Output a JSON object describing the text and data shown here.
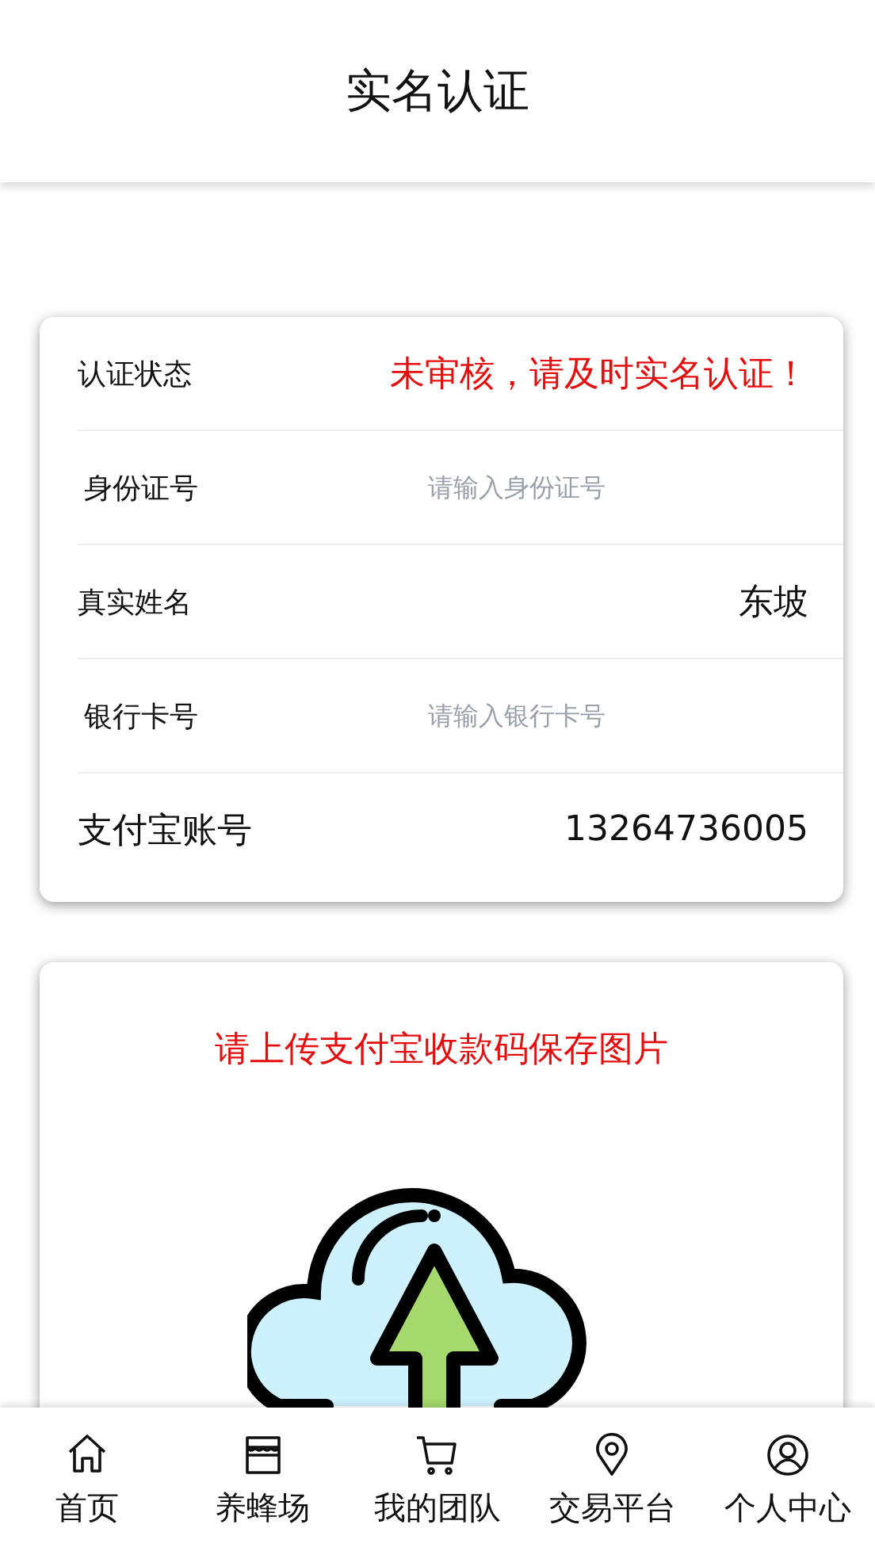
{
  "header": {
    "title": "实名认证"
  },
  "form": [
    {
      "kind": "status",
      "label": "认证状态",
      "value": "未审核，请及时实名认证！"
    },
    {
      "kind": "input",
      "label": "身份证号",
      "placeholder": "请输入身份证号"
    },
    {
      "kind": "value",
      "label": "真实姓名",
      "value": "东坡"
    },
    {
      "kind": "input",
      "label": "银行卡号",
      "placeholder": "请输入银行卡号"
    },
    {
      "kind": "value",
      "label": "支付宝账号",
      "value": "13264736005"
    }
  ],
  "upload": {
    "prompt": "请上传支付宝收款码保存图片"
  },
  "tab_bar": [
    {
      "kind": "home",
      "label": "首页"
    },
    {
      "kind": "shop",
      "label": "养蜂场"
    },
    {
      "kind": "cart",
      "label": "我的团队"
    },
    {
      "kind": "pin",
      "label": "交易平台"
    },
    {
      "kind": "user",
      "label": "个人中心"
    }
  ]
}
